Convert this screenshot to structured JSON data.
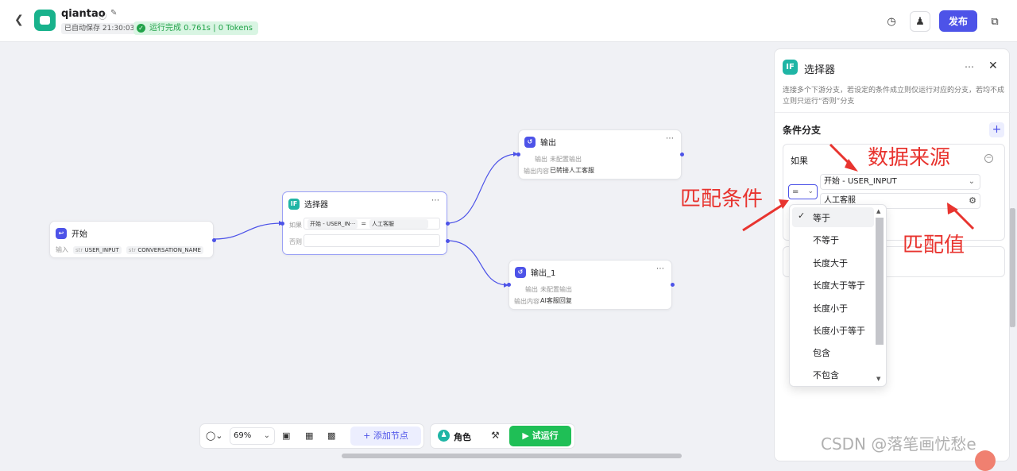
{
  "header": {
    "app_name": "qiantao",
    "autosave": "已自动保存 21:30:03",
    "run_status": "运行完成 0.761s | 0 Tokens",
    "publish": "发布"
  },
  "nodes": {
    "start": {
      "title": "开始",
      "label": "输入",
      "var1": "USER_INPUT",
      "var2": "CONVERSATION_NAME",
      "var_type": "str"
    },
    "selector": {
      "title": "选择器",
      "if_label": "如果",
      "if_source": "开始 - USER_IN···",
      "op": "=",
      "value": "人工客服",
      "else_label": "否则"
    },
    "output": {
      "title": "输出",
      "row1_label": "输出",
      "row1_value": "未配置输出",
      "row2_label": "输出内容",
      "row2_value": "已转接人工客服"
    },
    "output1": {
      "title": "输出_1",
      "row1_label": "输出",
      "row1_value": "未配置输出",
      "row2_label": "输出内容",
      "row2_value": "AI客服回复"
    }
  },
  "panel": {
    "badge": "IF",
    "title": "选择器",
    "desc": "连接多个下游分支，若设定的条件成立则仅运行对应的分支，若均不成立则只运行“否则”分支",
    "section": "条件分支",
    "if_label": "如果",
    "source": "开始 - USER_INPUT",
    "op": "=",
    "value": "人工客服"
  },
  "dropdown": {
    "options": [
      "等于",
      "不等于",
      "长度大于",
      "长度大于等于",
      "长度小于",
      "长度小于等于",
      "包含",
      "不包含"
    ],
    "selected": "等于"
  },
  "annotations": {
    "source": "数据来源",
    "condition": "匹配条件",
    "value": "匹配值"
  },
  "toolbar": {
    "zoom": "69%",
    "add_node": "添加节点",
    "role": "角色",
    "test_run": "试运行"
  },
  "watermark": "CSDN @落笔画忧愁e",
  "colors": {
    "accent": "#4d53e8",
    "success": "#22a34a",
    "annotation": "#e8342f",
    "if_badge": "#1fb5a5"
  }
}
